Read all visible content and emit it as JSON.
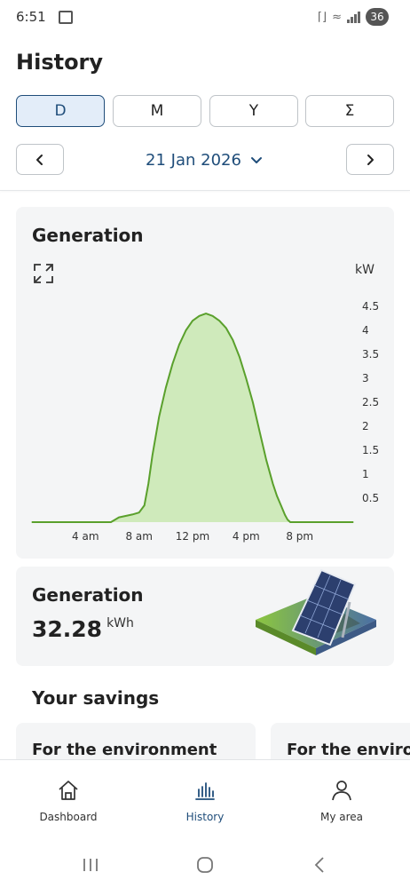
{
  "status_bar": {
    "time": "6:51",
    "battery": "36"
  },
  "page": {
    "title": "History"
  },
  "period_tabs": [
    {
      "label": "D",
      "active": true
    },
    {
      "label": "M",
      "active": false
    },
    {
      "label": "Y",
      "active": false
    },
    {
      "label": "Σ",
      "active": false
    }
  ],
  "date_nav": {
    "date": "21 Jan 2026",
    "prev_icon": "chevron-left-icon",
    "next_icon": "chevron-right-icon",
    "dropdown_icon": "chevron-down-icon"
  },
  "generation_card": {
    "title": "Generation",
    "expand_icon": "expand-icon",
    "unit": "kW"
  },
  "chart_data": {
    "type": "area",
    "title": "Generation",
    "xlabel": "",
    "ylabel": "kW",
    "ylim": [
      0,
      4.5
    ],
    "xlim": [
      0,
      24
    ],
    "x_ticks": [
      {
        "x": 4,
        "label": "4 am"
      },
      {
        "x": 8,
        "label": "8 am"
      },
      {
        "x": 12,
        "label": "12 pm"
      },
      {
        "x": 16,
        "label": "4 pm"
      },
      {
        "x": 20,
        "label": "8 pm"
      }
    ],
    "y_ticks": [
      {
        "y": 0.5,
        "label": "0.5"
      },
      {
        "y": 1,
        "label": "1"
      },
      {
        "y": 1.5,
        "label": "1.5"
      },
      {
        "y": 2,
        "label": "2"
      },
      {
        "y": 2.5,
        "label": "2.5"
      },
      {
        "y": 3,
        "label": "3"
      },
      {
        "y": 3.5,
        "label": "3.5"
      },
      {
        "y": 4,
        "label": "4"
      },
      {
        "y": 4.5,
        "label": "4.5"
      }
    ],
    "grid": false,
    "series": [
      {
        "color": "#5aa02c",
        "fill": "#cfeabb",
        "x": [
          0,
          5.9,
          6.5,
          7,
          7.5,
          8,
          8.4,
          8.7,
          9,
          9.5,
          10,
          10.5,
          11,
          11.5,
          12,
          12.5,
          13,
          13.5,
          14,
          14.5,
          15,
          15.5,
          16,
          16.5,
          17,
          17.5,
          18,
          18.3,
          18.6,
          18.9,
          19.1,
          19.3,
          24
        ],
        "y": [
          0,
          0,
          0.1,
          0.13,
          0.16,
          0.2,
          0.35,
          0.8,
          1.4,
          2.2,
          2.8,
          3.3,
          3.7,
          4.0,
          4.2,
          4.3,
          4.35,
          4.3,
          4.2,
          4.05,
          3.8,
          3.45,
          3.0,
          2.5,
          1.9,
          1.3,
          0.8,
          0.55,
          0.35,
          0.15,
          0.05,
          0,
          0
        ]
      }
    ]
  },
  "generation_total": {
    "title": "Generation",
    "value": "32.28",
    "unit": "kWh",
    "illustration": "solar-panel-illustration"
  },
  "savings": {
    "title": "Your savings",
    "cards": [
      {
        "title": "For the environment"
      },
      {
        "title": "For the environment"
      }
    ]
  },
  "bottom_nav": [
    {
      "label": "Dashboard",
      "icon": "home-icon",
      "active": false
    },
    {
      "label": "History",
      "icon": "bar-chart-icon",
      "active": true
    },
    {
      "label": "My area",
      "icon": "person-icon",
      "active": false
    }
  ],
  "system_nav": {
    "recents_icon": "recents-icon",
    "home_icon": "home-button-icon",
    "back_icon": "back-icon"
  },
  "colors": {
    "accent": "#1f4d7a",
    "series_line": "#5aa02c",
    "series_fill": "#cfeabb",
    "card_bg": "#f4f5f6"
  }
}
